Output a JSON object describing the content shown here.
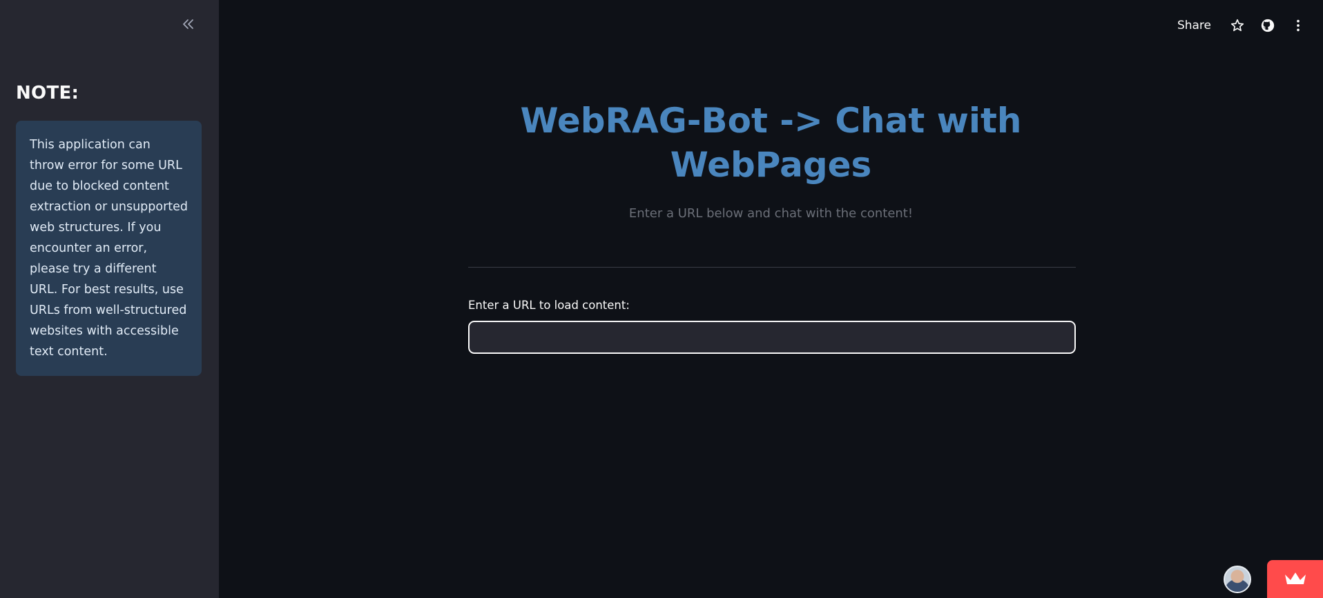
{
  "sidebar": {
    "collapse_icon": "chevrons-left-icon",
    "note_title": "NOTE:",
    "note_text": "This application can throw error for some URL due to blocked content extraction or unsupported web structures. If you encounter an error, please try a different URL. For best results, use URLs from well-structured websites with accessible text content."
  },
  "header": {
    "share_label": "Share",
    "star_icon": "star-icon",
    "github_icon": "github-icon",
    "menu_icon": "more-vertical-icon"
  },
  "main": {
    "title_line1": "WebRAG-Bot -> Chat with",
    "title_line2": "WebPages",
    "subtitle": "Enter a URL below and chat with the content!",
    "url_label": "Enter a URL to load content:",
    "url_value": "",
    "url_placeholder": ""
  },
  "footer": {
    "avatar_icon": "user-avatar",
    "badge_icon": "crown-icon"
  },
  "colors": {
    "background": "#0e1117",
    "sidebar": "#262730",
    "note_box": "#293d54",
    "title": "#4a86be",
    "badge": "#ff4b4b"
  }
}
